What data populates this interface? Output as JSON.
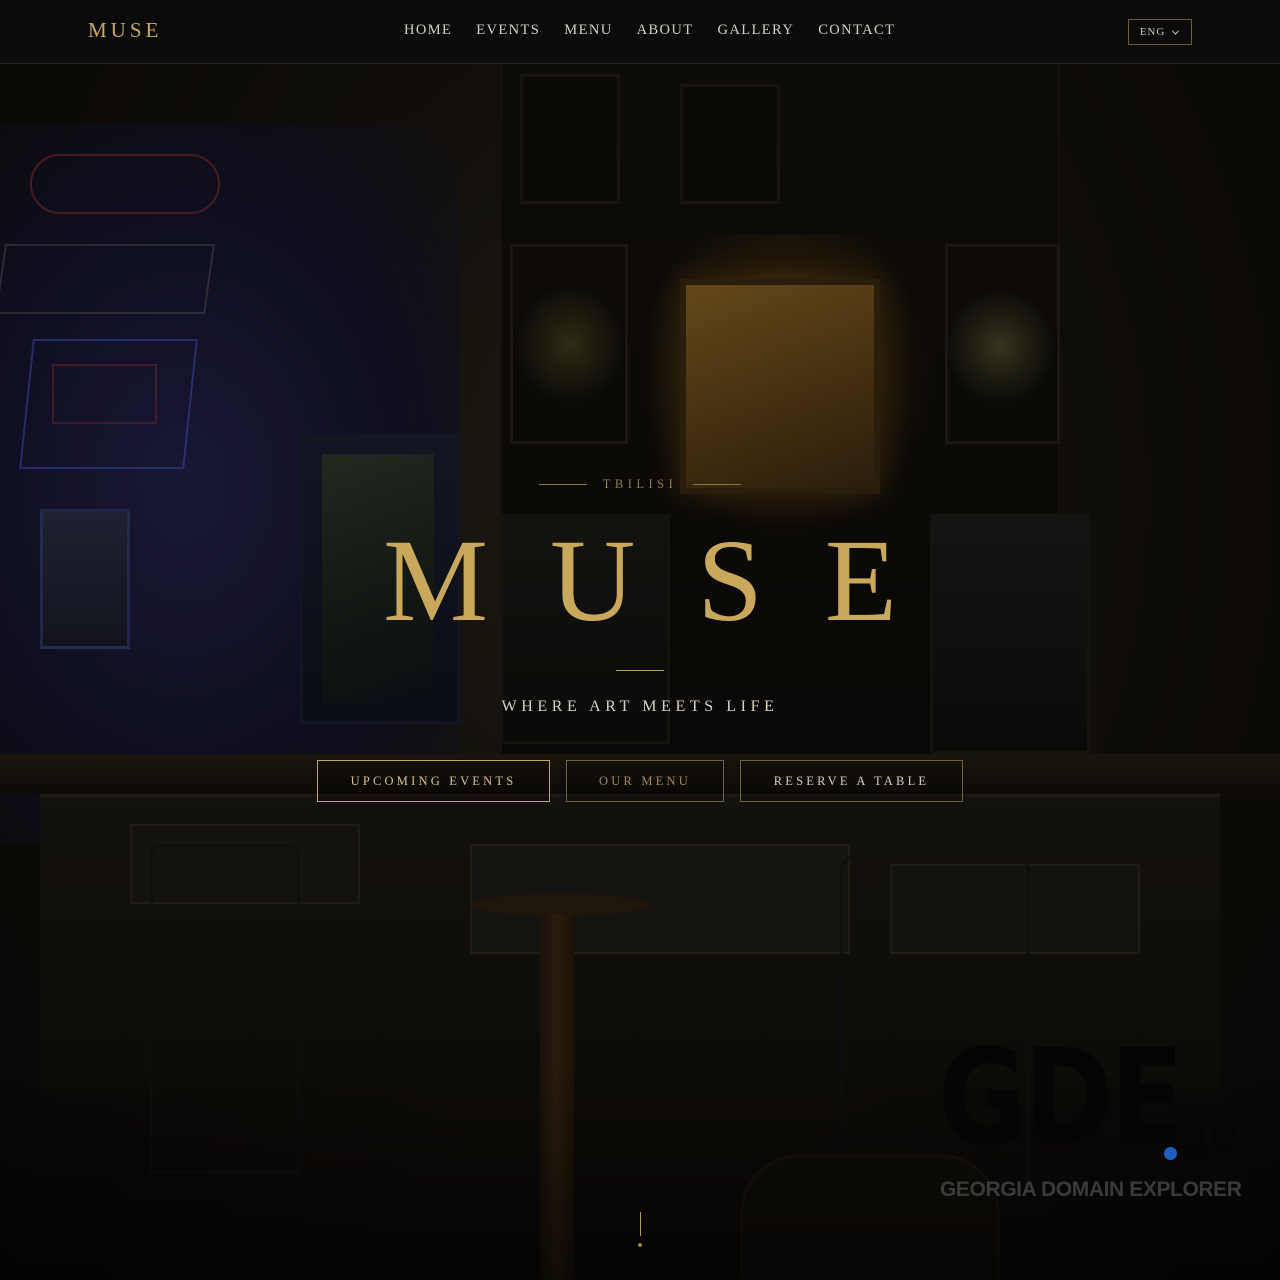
{
  "header": {
    "logo": "MUSE",
    "nav": [
      "HOME",
      "EVENTS",
      "MENU",
      "ABOUT",
      "GALLERY",
      "CONTACT"
    ],
    "language": "ENG"
  },
  "hero": {
    "city": "TBILISI",
    "title": "MUSE",
    "tagline": "WHERE ART MEETS LIFE",
    "buttons": {
      "events": "UPCOMING EVENTS",
      "menu": "OUR MENU",
      "reserve": "RESERVE A TABLE"
    }
  },
  "watermark": {
    "mark": "GDE",
    "tld": "ge",
    "subtitle": "GEORGIA DOMAIN EXPLORER"
  },
  "colors": {
    "accent_gold": "#c9a85c",
    "header_bg": "#0b0b0b",
    "watermark_dot": "#1f5fbf"
  },
  "icons": {
    "language_dropdown": "chevron-down-icon",
    "scroll_indicator": "scroll-down-indicator"
  }
}
